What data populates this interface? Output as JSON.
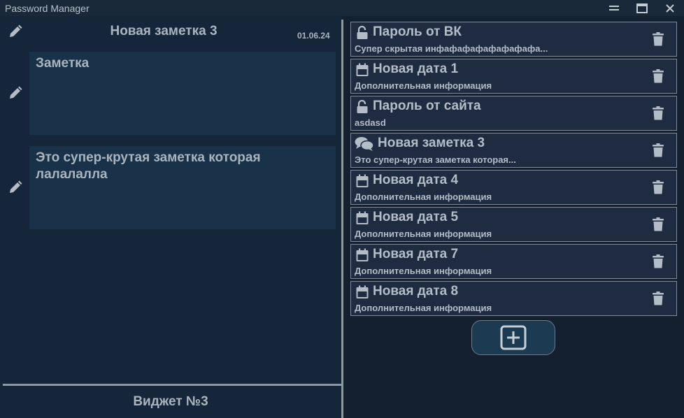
{
  "window": {
    "title": "Password Manager"
  },
  "note": {
    "title": "Новая заметка 3",
    "date": "01.06.24",
    "name_field": "Заметка",
    "content_field": "Это супер-крутая заметка которая лалалалла"
  },
  "widget": {
    "label": "Виджет №3"
  },
  "entries": [
    {
      "icon": "unlock-icon",
      "title": "Пароль от ВК",
      "subtitle": "Супер скрытая инфафафафафафафафа..."
    },
    {
      "icon": "calendar-icon",
      "title": "Новая дата 1",
      "subtitle": "Дополнительная информация"
    },
    {
      "icon": "unlock-icon",
      "title": "Пароль от сайта",
      "subtitle": "asdasd"
    },
    {
      "icon": "comments-icon",
      "title": "Новая заметка 3",
      "subtitle": "Это супер-крутая заметка которая..."
    },
    {
      "icon": "calendar-icon",
      "title": "Новая дата 4",
      "subtitle": "Дополнительная информация"
    },
    {
      "icon": "calendar-icon",
      "title": "Новая дата 5",
      "subtitle": "Дополнительная информация"
    },
    {
      "icon": "calendar-icon",
      "title": "Новая дата 7",
      "subtitle": "Дополнительная информация"
    },
    {
      "icon": "calendar-icon",
      "title": "Новая дата 8",
      "subtitle": "Дополнительная информация"
    }
  ],
  "colors": {
    "background": "#152233",
    "entry_bg": "#1e2b40",
    "text": "#b4bdc7",
    "add_button_bg": "#1c3a52"
  }
}
